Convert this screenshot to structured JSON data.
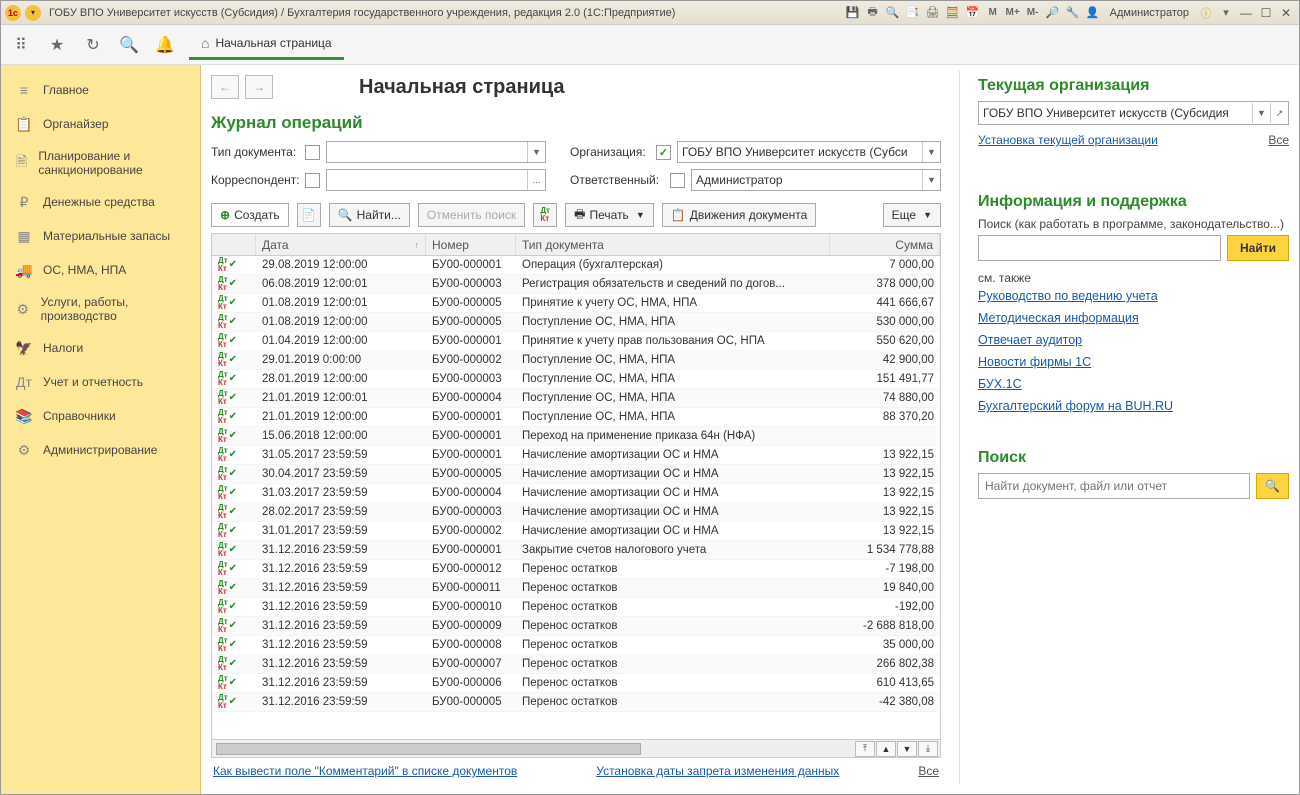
{
  "titlebar": {
    "title": "ГОБУ ВПО Университет искусств (Субсидия) / Бухгалтерия государственного учреждения, редакция 2.0  (1С:Предприятие)",
    "user": "Администратор"
  },
  "tab": {
    "home_label": "Начальная страница"
  },
  "sidebar": {
    "items": [
      {
        "label": "Главное",
        "icon": "≡"
      },
      {
        "label": "Органайзер",
        "icon": "📋"
      },
      {
        "label": "Планирование и санкционирование",
        "icon": "🗎"
      },
      {
        "label": "Денежные средства",
        "icon": "₽"
      },
      {
        "label": "Материальные запасы",
        "icon": "▦"
      },
      {
        "label": "ОС, НМА, НПА",
        "icon": "🚚"
      },
      {
        "label": "Услуги, работы, производство",
        "icon": "⚙"
      },
      {
        "label": "Налоги",
        "icon": "🦅"
      },
      {
        "label": "Учет и отчетность",
        "icon": "Дт"
      },
      {
        "label": "Справочники",
        "icon": "📚"
      },
      {
        "label": "Администрирование",
        "icon": "⚙"
      }
    ]
  },
  "page": {
    "title": "Начальная страница",
    "journal_title": "Журнал операций",
    "filters": {
      "doctype_label": "Тип документа:",
      "doctype_value": "",
      "org_label": "Организация:",
      "org_value": "ГОБУ ВПО Университет искусств (Субси",
      "corr_label": "Корреспондент:",
      "corr_value": "",
      "resp_label": "Ответственный:",
      "resp_value": "Администратор"
    },
    "actions": {
      "create": "Создать",
      "find": "Найти...",
      "cancel_search": "Отменить поиск",
      "print": "Печать",
      "movements": "Движения документа",
      "more": "Еще"
    },
    "columns": {
      "date": "Дата",
      "number": "Номер",
      "type": "Тип документа",
      "sum": "Сумма"
    },
    "rows": [
      {
        "date": "29.08.2019 12:00:00",
        "num": "БУ00-000001",
        "type": "Операция (бухгалтерская)",
        "sum": "7 000,00"
      },
      {
        "date": "06.08.2019 12:00:01",
        "num": "БУ00-000003",
        "type": "Регистрация обязательств и сведений по догов...",
        "sum": "378 000,00"
      },
      {
        "date": "01.08.2019 12:00:01",
        "num": "БУ00-000005",
        "type": "Принятие к учету ОС, НМА, НПА",
        "sum": "441 666,67"
      },
      {
        "date": "01.08.2019 12:00:00",
        "num": "БУ00-000005",
        "type": "Поступление ОС, НМА, НПА",
        "sum": "530 000,00"
      },
      {
        "date": "01.04.2019 12:00:00",
        "num": "БУ00-000001",
        "type": "Принятие к учету прав пользования ОС, НПА",
        "sum": "550 620,00"
      },
      {
        "date": "29.01.2019 0:00:00",
        "num": "БУ00-000002",
        "type": "Поступление ОС, НМА, НПА",
        "sum": "42 900,00"
      },
      {
        "date": "28.01.2019 12:00:00",
        "num": "БУ00-000003",
        "type": "Поступление ОС, НМА, НПА",
        "sum": "151 491,77"
      },
      {
        "date": "21.01.2019 12:00:01",
        "num": "БУ00-000004",
        "type": "Поступление ОС, НМА, НПА",
        "sum": "74 880,00"
      },
      {
        "date": "21.01.2019 12:00:00",
        "num": "БУ00-000001",
        "type": "Поступление ОС, НМА, НПА",
        "sum": "88 370,20"
      },
      {
        "date": "15.06.2018 12:00:00",
        "num": "БУ00-000001",
        "type": "Переход на применение приказа 64н (НФА)",
        "sum": ""
      },
      {
        "date": "31.05.2017 23:59:59",
        "num": "БУ00-000001",
        "type": "Начисление амортизации ОС и НМА",
        "sum": "13 922,15"
      },
      {
        "date": "30.04.2017 23:59:59",
        "num": "БУ00-000005",
        "type": "Начисление амортизации ОС и НМА",
        "sum": "13 922,15"
      },
      {
        "date": "31.03.2017 23:59:59",
        "num": "БУ00-000004",
        "type": "Начисление амортизации ОС и НМА",
        "sum": "13 922,15"
      },
      {
        "date": "28.02.2017 23:59:59",
        "num": "БУ00-000003",
        "type": "Начисление амортизации ОС и НМА",
        "sum": "13 922,15"
      },
      {
        "date": "31.01.2017 23:59:59",
        "num": "БУ00-000002",
        "type": "Начисление амортизации ОС и НМА",
        "sum": "13 922,15"
      },
      {
        "date": "31.12.2016 23:59:59",
        "num": "БУ00-000001",
        "type": "Закрытие счетов налогового учета",
        "sum": "1 534 778,88"
      },
      {
        "date": "31.12.2016 23:59:59",
        "num": "БУ00-000012",
        "type": "Перенос остатков",
        "sum": "-7 198,00"
      },
      {
        "date": "31.12.2016 23:59:59",
        "num": "БУ00-000011",
        "type": "Перенос остатков",
        "sum": "19 840,00"
      },
      {
        "date": "31.12.2016 23:59:59",
        "num": "БУ00-000010",
        "type": "Перенос остатков",
        "sum": "-192,00"
      },
      {
        "date": "31.12.2016 23:59:59",
        "num": "БУ00-000009",
        "type": "Перенос остатков",
        "sum": "-2 688 818,00"
      },
      {
        "date": "31.12.2016 23:59:59",
        "num": "БУ00-000008",
        "type": "Перенос остатков",
        "sum": "35 000,00"
      },
      {
        "date": "31.12.2016 23:59:59",
        "num": "БУ00-000007",
        "type": "Перенос остатков",
        "sum": "266 802,38"
      },
      {
        "date": "31.12.2016 23:59:59",
        "num": "БУ00-000006",
        "type": "Перенос остатков",
        "sum": "610 413,65"
      },
      {
        "date": "31.12.2016 23:59:59",
        "num": "БУ00-000005",
        "type": "Перенос остатков",
        "sum": "-42 380,08"
      }
    ],
    "footer": {
      "link_comment": "Как вывести поле \"Комментарий\" в списке документов",
      "link_date": "Установка даты запрета изменения данных",
      "all": "Все"
    }
  },
  "right": {
    "org_title": "Текущая организация",
    "org_value": "ГОБУ ВПО Университет искусств (Субсидия",
    "org_set_link": "Установка текущей организации",
    "all": "Все",
    "info_title": "Информация и поддержка",
    "info_hint": "Поиск (как работать в программе, законодательство...)",
    "find": "Найти",
    "see_also": "см. также",
    "links": [
      "Руководство по ведению учета",
      "Методическая информация",
      "Отвечает аудитор",
      "Новости фирмы 1С",
      "БУХ.1С",
      "Бухгалтерский форум на BUH.RU"
    ],
    "search_title": "Поиск",
    "search_placeholder": "Найти документ, файл или отчет"
  }
}
